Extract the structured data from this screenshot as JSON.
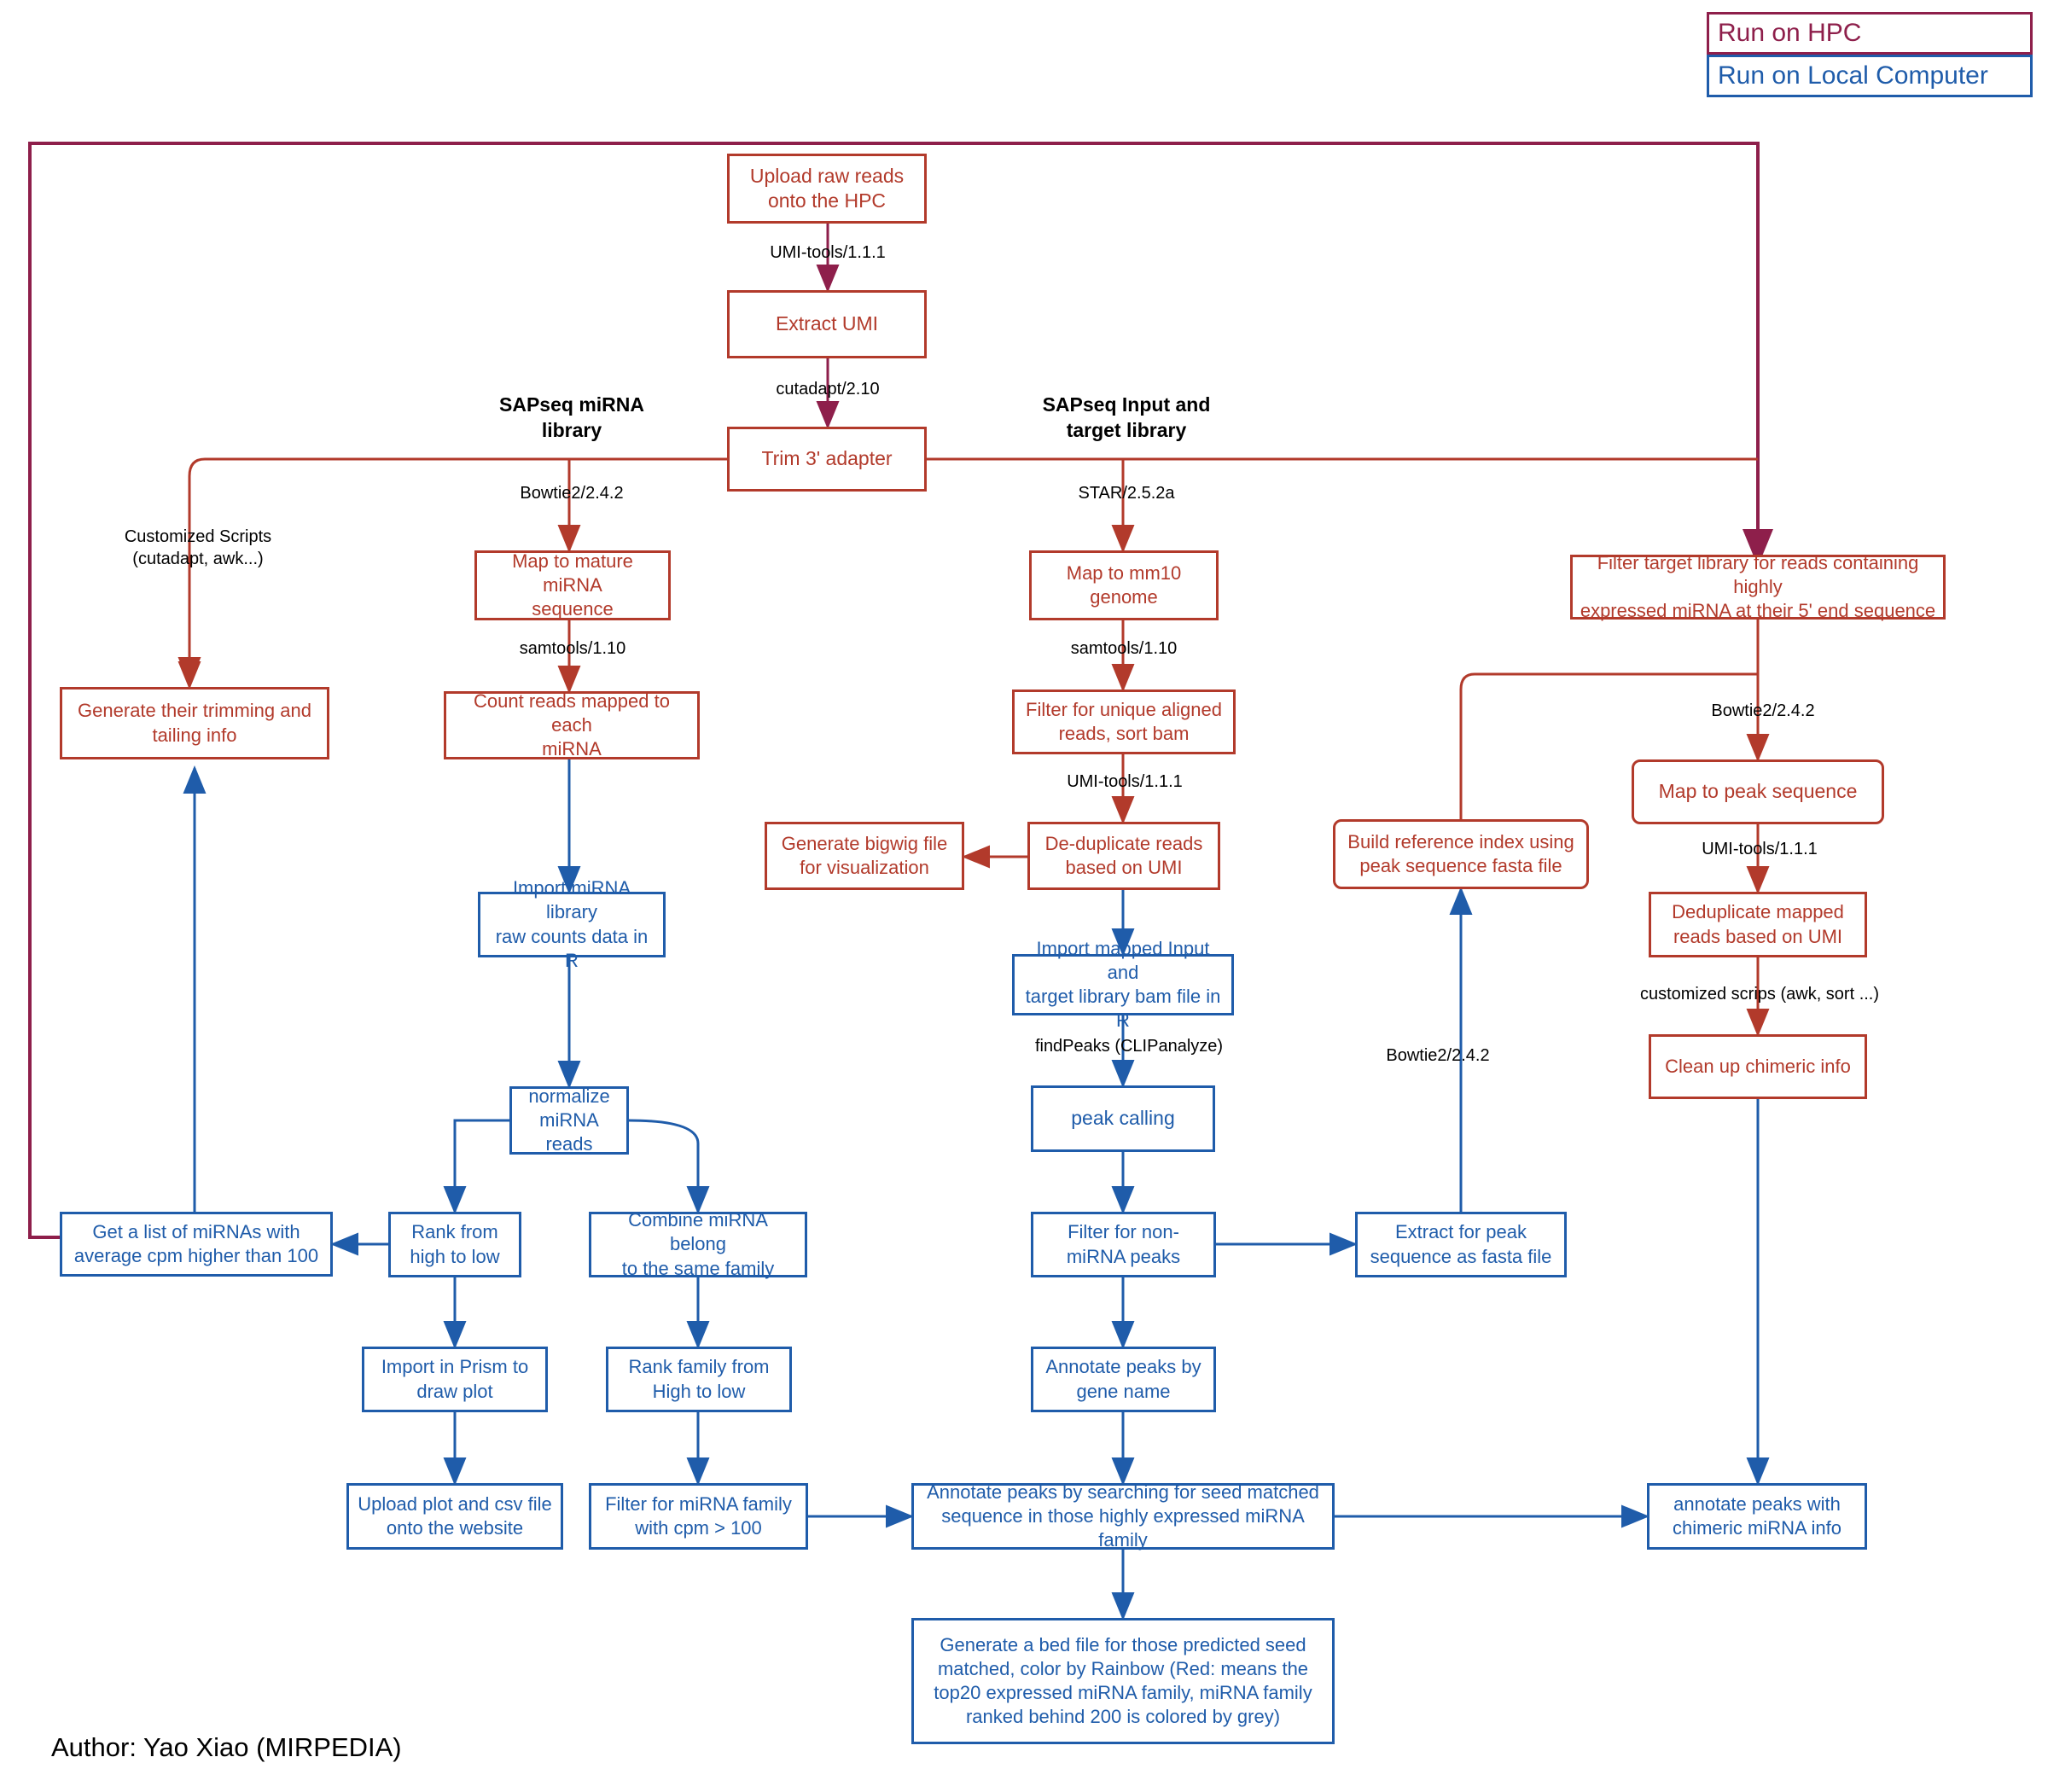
{
  "legend": {
    "hpc_label": "Run on HPC",
    "local_label": "Run on Local Computer",
    "hpc_color": "#8e1f4b",
    "local_color": "#1f5caa"
  },
  "colors": {
    "hpc_box": "#b23a2b",
    "local_box": "#1f5caa",
    "boundary": "#8e1f4b",
    "edge_label": "#000000"
  },
  "section_titles": {
    "mirna_library": "SAPseq miRNA\nlibrary",
    "input_target_library": "SAPseq Input and\ntarget library"
  },
  "author": "Author: Yao Xiao (MIRPEDIA)",
  "nodes": [
    {
      "id": "upload",
      "label": "Upload raw reads\nonto the HPC",
      "env": "hpc"
    },
    {
      "id": "extract_umi",
      "label": "Extract UMI",
      "env": "hpc"
    },
    {
      "id": "trim_adapter",
      "label": "Trim 3' adapter",
      "env": "hpc"
    },
    {
      "id": "gen_trim_tail",
      "label": "Generate their trimming and\ntailing info",
      "env": "hpc"
    },
    {
      "id": "map_mature",
      "label": "Map to mature miRNA\nsequence",
      "env": "hpc"
    },
    {
      "id": "count_reads",
      "label": "Count reads mapped to each\nmiRNA",
      "env": "hpc"
    },
    {
      "id": "map_mm10",
      "label": "Map to mm10\ngenome",
      "env": "hpc"
    },
    {
      "id": "filter_unique",
      "label": "Filter for unique aligned\nreads, sort bam",
      "env": "hpc"
    },
    {
      "id": "dedup_umi",
      "label": "De-duplicate reads\nbased on UMI",
      "env": "hpc"
    },
    {
      "id": "gen_bigwig",
      "label": "Generate bigwig file\nfor visualization",
      "env": "hpc"
    },
    {
      "id": "build_ref_index",
      "label": "Build reference index using\npeak sequence fasta file",
      "env": "hpc"
    },
    {
      "id": "filter_target_lib",
      "label": "Filter target library for reads containing highly\nexpressed miRNA at their 5' end sequence",
      "env": "hpc"
    },
    {
      "id": "map_peak_seq",
      "label": "Map to peak sequence",
      "env": "hpc"
    },
    {
      "id": "dedup_mapped",
      "label": "Deduplicate mapped\nreads based on UMI",
      "env": "hpc"
    },
    {
      "id": "clean_chimeric",
      "label": "Clean up chimeric info",
      "env": "hpc"
    },
    {
      "id": "import_mirna_lib",
      "label": "Import miRNA library\nraw counts data in R",
      "env": "local"
    },
    {
      "id": "normalize",
      "label": "normalize\nmiRNA reads",
      "env": "local"
    },
    {
      "id": "get_list_mirnas",
      "label": "Get a list of miRNAs with\naverage cpm higher than 100",
      "env": "local"
    },
    {
      "id": "rank_high_low",
      "label": "Rank from\nhigh to low",
      "env": "local"
    },
    {
      "id": "combine_family",
      "label": "Combine miRNA belong\nto the same family",
      "env": "local"
    },
    {
      "id": "import_prism",
      "label": "Import in Prism to\ndraw plot",
      "env": "local"
    },
    {
      "id": "rank_family",
      "label": "Rank family from\nHigh to low",
      "env": "local"
    },
    {
      "id": "upload_plot",
      "label": "Upload plot and csv file\nonto the website",
      "env": "local"
    },
    {
      "id": "filter_family_cpm",
      "label": "Filter for miRNA family\nwith cpm > 100",
      "env": "local"
    },
    {
      "id": "import_bam",
      "label": "Import mapped Input and\ntarget library bam file in R",
      "env": "local"
    },
    {
      "id": "peak_calling",
      "label": "peak calling",
      "env": "local"
    },
    {
      "id": "filter_non_mirna",
      "label": "Filter for non-\nmiRNA peaks",
      "env": "local"
    },
    {
      "id": "extract_peak_seq",
      "label": "Extract for peak\nsequence as fasta file",
      "env": "local"
    },
    {
      "id": "annotate_gene",
      "label": "Annotate peaks by\ngene name",
      "env": "local"
    },
    {
      "id": "annotate_seed",
      "label": "Annotate peaks by searching for seed matched\nsequence in those highly expressed miRNA family",
      "env": "local"
    },
    {
      "id": "annotate_chimeric",
      "label": "annotate peaks with\nchimeric miRNA info",
      "env": "local"
    },
    {
      "id": "gen_bed",
      "label": "Generate a bed file for those predicted seed\nmatched, color by Rainbow (Red: means the\ntop20 expressed miRNA family, miRNA family\nranked behind 200 is colored by grey)",
      "env": "local"
    }
  ],
  "edge_labels": [
    {
      "id": "e1",
      "text": "UMI-tools/1.1.1"
    },
    {
      "id": "e2",
      "text": "cutadapt/2.10"
    },
    {
      "id": "e3",
      "text": "Customized Scripts\n(cutadapt, awk...)"
    },
    {
      "id": "e4",
      "text": "Bowtie2/2.4.2"
    },
    {
      "id": "e5",
      "text": "samtools/1.10"
    },
    {
      "id": "e6",
      "text": "STAR/2.5.2a"
    },
    {
      "id": "e7",
      "text": "samtools/1.10"
    },
    {
      "id": "e8",
      "text": "UMI-tools/1.1.1"
    },
    {
      "id": "e9",
      "text": "Bowtie2/2.4.2"
    },
    {
      "id": "e10",
      "text": "UMI-tools/1.1.1"
    },
    {
      "id": "e11",
      "text": "customized scrips (awk, sort ...)"
    },
    {
      "id": "e12",
      "text": "findPeaks (CLIPanalyze)"
    },
    {
      "id": "e13",
      "text": "Bowtie2/2.4.2"
    }
  ]
}
